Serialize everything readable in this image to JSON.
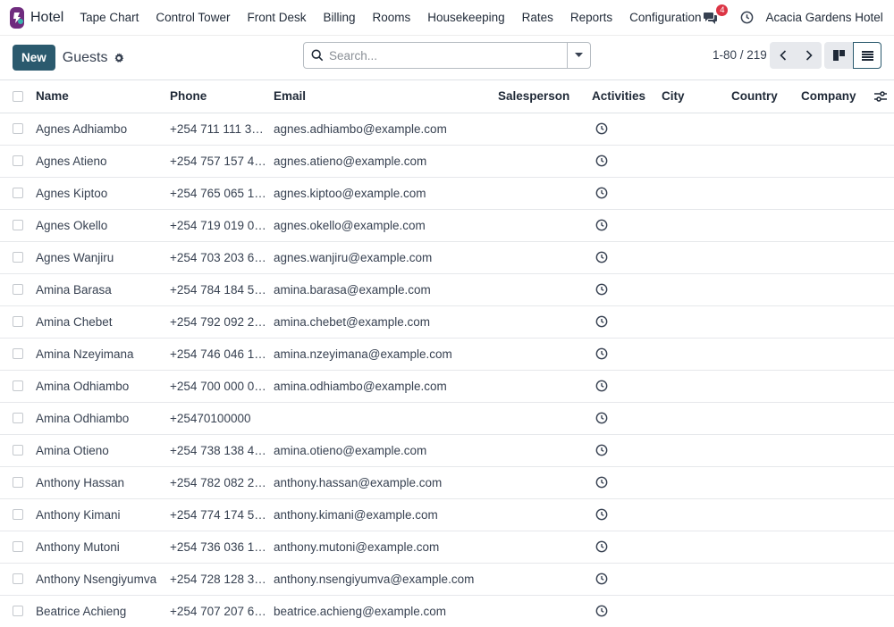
{
  "navbar": {
    "app_name": "Hotel",
    "menu": [
      "Tape Chart",
      "Control Tower",
      "Front Desk",
      "Billing",
      "Rooms",
      "Housekeeping",
      "Rates",
      "Reports",
      "Configuration"
    ],
    "messages_count": "4",
    "company": "Acacia Gardens Hotel"
  },
  "control": {
    "new_label": "New",
    "title": "Guests",
    "search_placeholder": "Search...",
    "pager": "1-80 / 219"
  },
  "table": {
    "columns": [
      "Name",
      "Phone",
      "Email",
      "Salesperson",
      "Activities",
      "City",
      "Country",
      "Company"
    ],
    "rows": [
      {
        "name": "Agnes Adhiambo",
        "phone": "+254 711 111 3…",
        "email": "agnes.adhiambo@example.com"
      },
      {
        "name": "Agnes Atieno",
        "phone": "+254 757 157 4…",
        "email": "agnes.atieno@example.com"
      },
      {
        "name": "Agnes Kiptoo",
        "phone": "+254 765 065 1…",
        "email": "agnes.kiptoo@example.com"
      },
      {
        "name": "Agnes Okello",
        "phone": "+254 719 019 0…",
        "email": "agnes.okello@example.com"
      },
      {
        "name": "Agnes Wanjiru",
        "phone": "+254 703 203 6…",
        "email": "agnes.wanjiru@example.com"
      },
      {
        "name": "Amina Barasa",
        "phone": "+254 784 184 5…",
        "email": "amina.barasa@example.com"
      },
      {
        "name": "Amina Chebet",
        "phone": "+254 792 092 2…",
        "email": "amina.chebet@example.com"
      },
      {
        "name": "Amina Nzeyimana",
        "phone": "+254 746 046 1…",
        "email": "amina.nzeyimana@example.com"
      },
      {
        "name": "Amina Odhiambo",
        "phone": "+254 700 000 0…",
        "email": "amina.odhiambo@example.com"
      },
      {
        "name": "Amina Odhiambo",
        "phone": "+25470100000",
        "email": ""
      },
      {
        "name": "Amina Otieno",
        "phone": "+254 738 138 4…",
        "email": "amina.otieno@example.com"
      },
      {
        "name": "Anthony Hassan",
        "phone": "+254 782 082 2…",
        "email": "anthony.hassan@example.com"
      },
      {
        "name": "Anthony Kimani",
        "phone": "+254 774 174 5…",
        "email": "anthony.kimani@example.com"
      },
      {
        "name": "Anthony Mutoni",
        "phone": "+254 736 036 1…",
        "email": "anthony.mutoni@example.com"
      },
      {
        "name": "Anthony Nsengiyumva",
        "phone": "+254 728 128 3…",
        "email": "anthony.nsengiyumva@example.com"
      },
      {
        "name": "Beatrice Achieng",
        "phone": "+254 707 207 6…",
        "email": "beatrice.achieng@example.com"
      }
    ]
  },
  "colors": {
    "primary": "#2b5a6e",
    "brand": "#6f2b7e",
    "badge": "#dc3545"
  },
  "icons": [
    "app-logo-icon",
    "chat-icon",
    "clock-icon",
    "avatar",
    "gear-icon",
    "search-icon",
    "caret-down-icon",
    "chevron-left-icon",
    "chevron-right-icon",
    "kanban-view-icon",
    "list-view-icon",
    "column-settings-icon",
    "activity-clock-icon"
  ]
}
